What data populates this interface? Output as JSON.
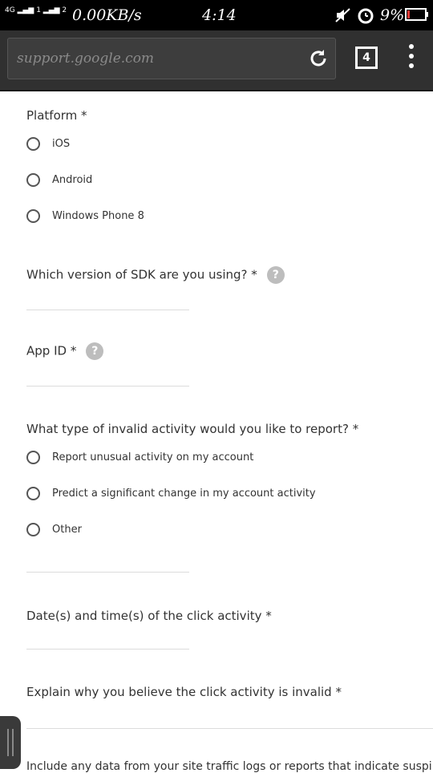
{
  "status_bar": {
    "signal": "4G",
    "sim2": "2",
    "speed": "0.00KB/s",
    "time": "4:14",
    "battery": "9%"
  },
  "browser": {
    "url": "support.google.com",
    "tab_count": "4",
    "icons": [
      "reload-icon",
      "tabs-icon",
      "menu-icon"
    ]
  },
  "form": {
    "platform": {
      "label": "Platform *",
      "options": [
        "iOS",
        "Android",
        "Windows Phone 8"
      ]
    },
    "sdk_version": {
      "label": "Which version of SDK are you using? *",
      "help": "?"
    },
    "app_id": {
      "label": "App ID *",
      "help": "?"
    },
    "invalid_activity": {
      "label": "What type of invalid activity would you like to report? *",
      "options": [
        "Report unusual activity on my account",
        "Predict a significant change in my account activity",
        "Other"
      ]
    },
    "dates": {
      "label": "Date(s) and time(s) of the click activity *"
    },
    "explain": {
      "label": "Explain why you believe the click activity is invalid *"
    },
    "truncated_text": "Include any data from your site traffic logs or reports that indicate suspi"
  },
  "colors": {
    "statusbar": "#000000",
    "toolbar": "#303030",
    "text": "#333333"
  }
}
